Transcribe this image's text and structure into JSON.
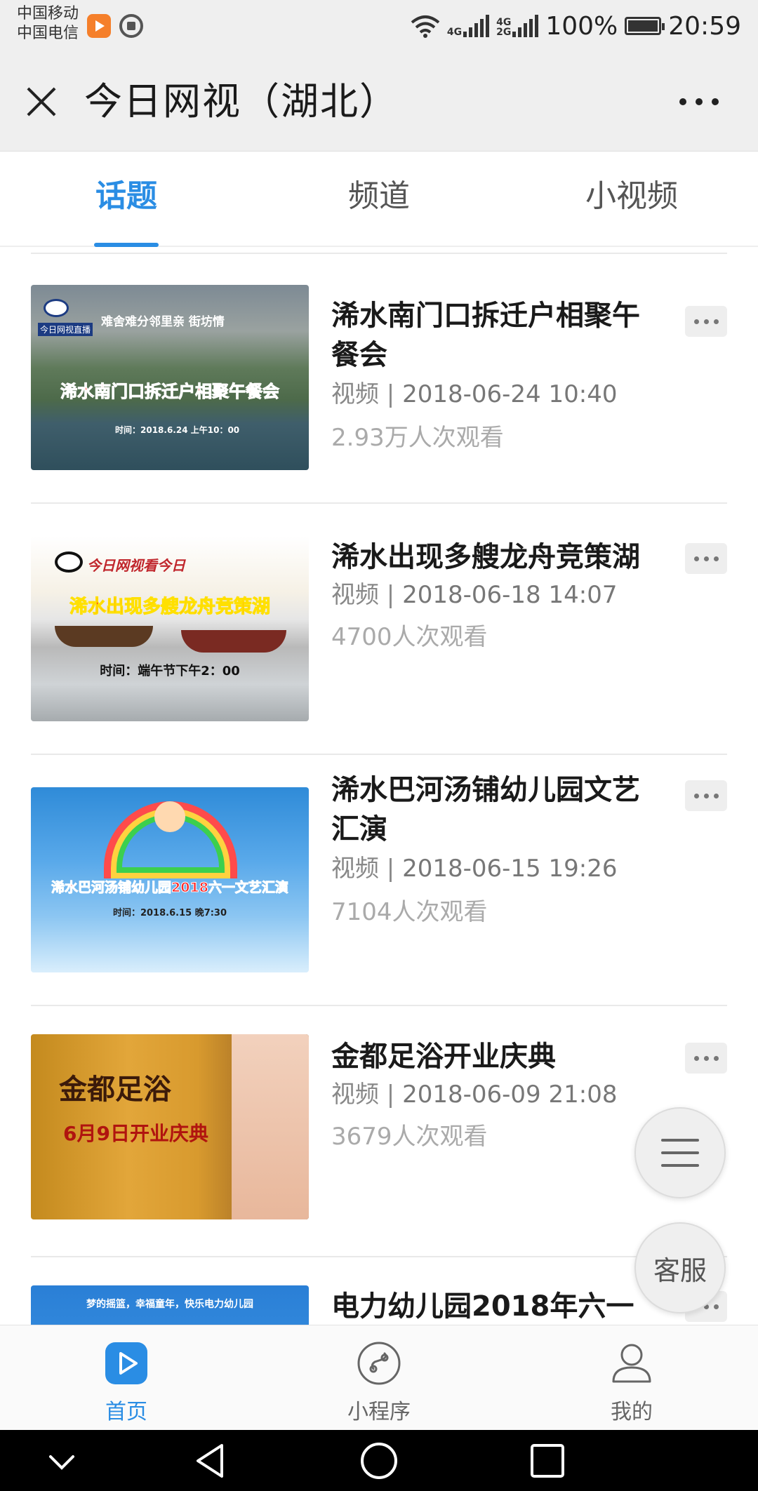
{
  "status_bar": {
    "carrier_1": "中国移动",
    "carrier_2": "中国电信",
    "net_1": "4G",
    "net_2": "4G",
    "net_3": "2G",
    "battery": "100%",
    "time": "20:59",
    "icons": [
      "video-app-icon",
      "shield-icon",
      "wifi-icon",
      "signal-icon",
      "battery-icon"
    ]
  },
  "header": {
    "title": "今日网视（湖北）",
    "close_icon": "close-icon",
    "more_icon": "more-icon"
  },
  "tabs": [
    {
      "label": "话题",
      "active": true
    },
    {
      "label": "频道",
      "active": false
    },
    {
      "label": "小视频",
      "active": false
    }
  ],
  "items": [
    {
      "title": "浠水南门口拆迁户相聚午餐会",
      "type": "视频 |",
      "date": "2018-06-24 10:40",
      "views": "2.93万人次观看",
      "thumb": {
        "badge": "今日网视直播",
        "banner": "难舍难分邻里亲 街坊情",
        "headline": "浠水南门口拆迁户相聚午餐会",
        "time": "时间：2018.6.24 上午10：00"
      }
    },
    {
      "title": "浠水出现多艘龙舟竞策湖",
      "type": "视频 |",
      "date": "2018-06-18 14:07",
      "views": "4700人次观看",
      "thumb": {
        "badge": "今日网视看今日",
        "headline": "浠水出现多艘龙舟竞策湖",
        "time": "时间：端午节下午2：00"
      }
    },
    {
      "title": "浠水巴河汤铺幼儿园文艺汇演",
      "type": "视频 |",
      "date": "2018-06-15 19:26",
      "views": "7104人次观看",
      "thumb": {
        "headline": "浠水巴河汤铺幼儿园2018六一文艺汇演",
        "time": "时间：2018.6.15 晚7:30"
      }
    },
    {
      "title": "金都足浴开业庆典",
      "type": "视频 |",
      "date": "2018-06-09 21:08",
      "views": "3679人次观看",
      "thumb": {
        "headline": "金都足浴",
        "subheadline": "6月9日开业庆典"
      }
    },
    {
      "title": "电力幼儿园2018年六一",
      "type": "",
      "date": "",
      "views": "",
      "thumb": {
        "headline": "梦的摇篮，幸福童年，快乐电力幼儿园"
      }
    }
  ],
  "floating": {
    "menu_icon": "menu-icon",
    "service_label": "客服"
  },
  "bottom_nav": [
    {
      "label": "首页",
      "icon": "play-icon",
      "active": true
    },
    {
      "label": "小程序",
      "icon": "mini-program-icon",
      "active": false
    },
    {
      "label": "我的",
      "icon": "user-icon",
      "active": false
    }
  ],
  "colors": {
    "accent": "#2a8de4",
    "title_bar_bg": "#efefef",
    "meta_text": "#888888",
    "views_text": "#aaaaaa"
  }
}
